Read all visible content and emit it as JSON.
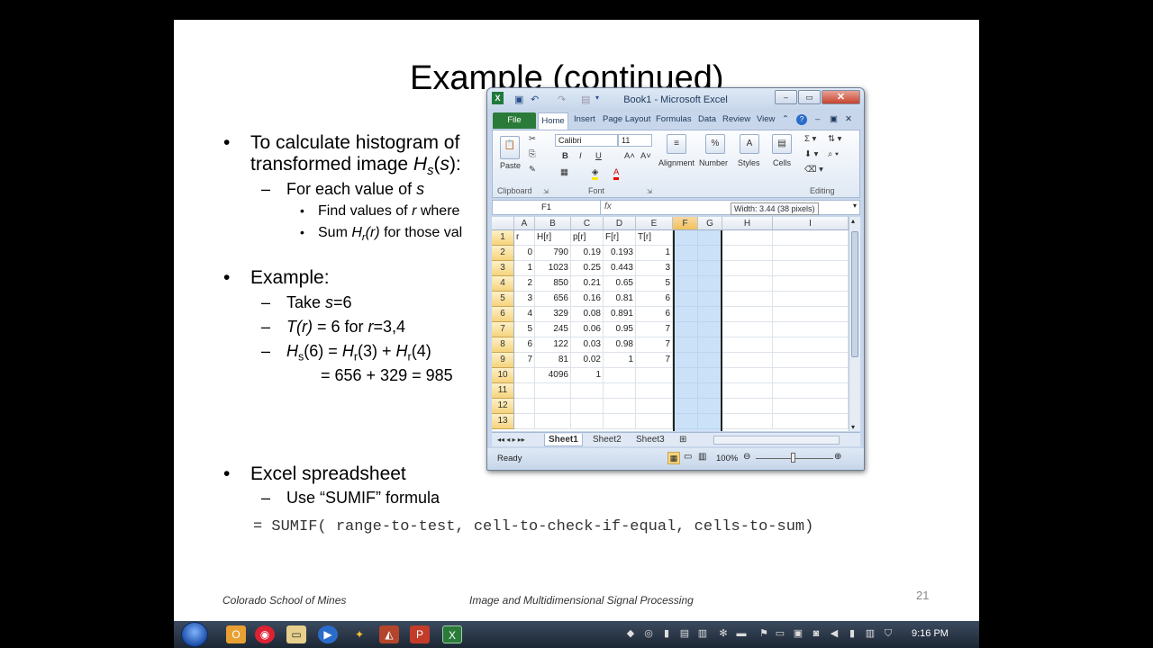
{
  "slide": {
    "title": "Example (continued)",
    "bullet1": {
      "line1": "To calculate histogram of",
      "line2_pre": "transformed image ",
      "line2_H": "H",
      "line2_sub": "s",
      "line2_post": "(",
      "line2_s": "s",
      "line2_end": "):"
    },
    "sub1": {
      "pre": "For each value of ",
      "s": "s"
    },
    "sub1a": {
      "pre": "Find values of ",
      "r": "r",
      "post": " where"
    },
    "sub1b": {
      "pre": "Sum ",
      "H": "H",
      "sub": "r",
      "r": "(r)",
      "post": " for those val"
    },
    "bullet2": "Example:",
    "ex1": {
      "pre": "Take ",
      "s": "s",
      "post": "=6"
    },
    "ex2": {
      "T": "T(r)",
      "mid": " = 6 for ",
      "r": "r",
      "post": "=3,4"
    },
    "ex3": {
      "H1": "H",
      "s1": "s",
      "a": "(6) = ",
      "H2": "H",
      "s2": "r",
      "b": "(3) + ",
      "H3": "H",
      "s3": "r",
      "c": "(4)"
    },
    "ex4": "= 656 + 329 = 985",
    "bullet3": "Excel spreadsheet",
    "sub3": "Use “SUMIF” formula",
    "formula": "= SUMIF( range-to-test, cell-to-check-if-equal, cells-to-sum)",
    "footer_left": "Colorado School of Mines",
    "footer_center": "Image and Multidimensional Signal Processing",
    "page_number": "21"
  },
  "excel": {
    "window_title": "Book1 - Microsoft Excel",
    "tabs": [
      "File",
      "Home",
      "Insert",
      "Page Layout",
      "Formulas",
      "Data",
      "Review",
      "View"
    ],
    "clipboard_label": "Clipboard",
    "paste_label": "Paste",
    "font_label": "Font",
    "font_name": "Calibri",
    "font_size": "11",
    "alignment_label": "Alignment",
    "number_label": "Number",
    "styles_label": "Styles",
    "cells_label": "Cells",
    "editing_label": "Editing",
    "name_box": "F1",
    "fx": "fx",
    "tooltip": "Width: 3.44 (38 pixels)",
    "columns": [
      "A",
      "B",
      "C",
      "D",
      "E",
      "F",
      "G",
      "H",
      "I"
    ],
    "rows": [
      [
        "r",
        "H[r]",
        "p[r]",
        "F[r]",
        "T[r]"
      ],
      [
        "0",
        "790",
        "0.19",
        "0.193",
        "1"
      ],
      [
        "1",
        "1023",
        "0.25",
        "0.443",
        "3"
      ],
      [
        "2",
        "850",
        "0.21",
        "0.65",
        "5"
      ],
      [
        "3",
        "656",
        "0.16",
        "0.81",
        "6"
      ],
      [
        "4",
        "329",
        "0.08",
        "0.891",
        "6"
      ],
      [
        "5",
        "245",
        "0.06",
        "0.95",
        "7"
      ],
      [
        "6",
        "122",
        "0.03",
        "0.98",
        "7"
      ],
      [
        "7",
        "81",
        "0.02",
        "1",
        "7"
      ],
      [
        "",
        "4096",
        "1",
        "",
        ""
      ],
      [
        "",
        "",
        "",
        "",
        ""
      ],
      [
        "",
        "",
        "",
        "",
        ""
      ],
      [
        "",
        "",
        "",
        "",
        ""
      ]
    ],
    "row_numbers": [
      "1",
      "2",
      "3",
      "4",
      "5",
      "6",
      "7",
      "8",
      "9",
      "10",
      "11",
      "12",
      "13"
    ],
    "sheets": [
      "Sheet1",
      "Sheet2",
      "Sheet3"
    ],
    "status": "Ready",
    "zoom": "100%"
  },
  "taskbar": {
    "clock": "9:16 PM"
  }
}
